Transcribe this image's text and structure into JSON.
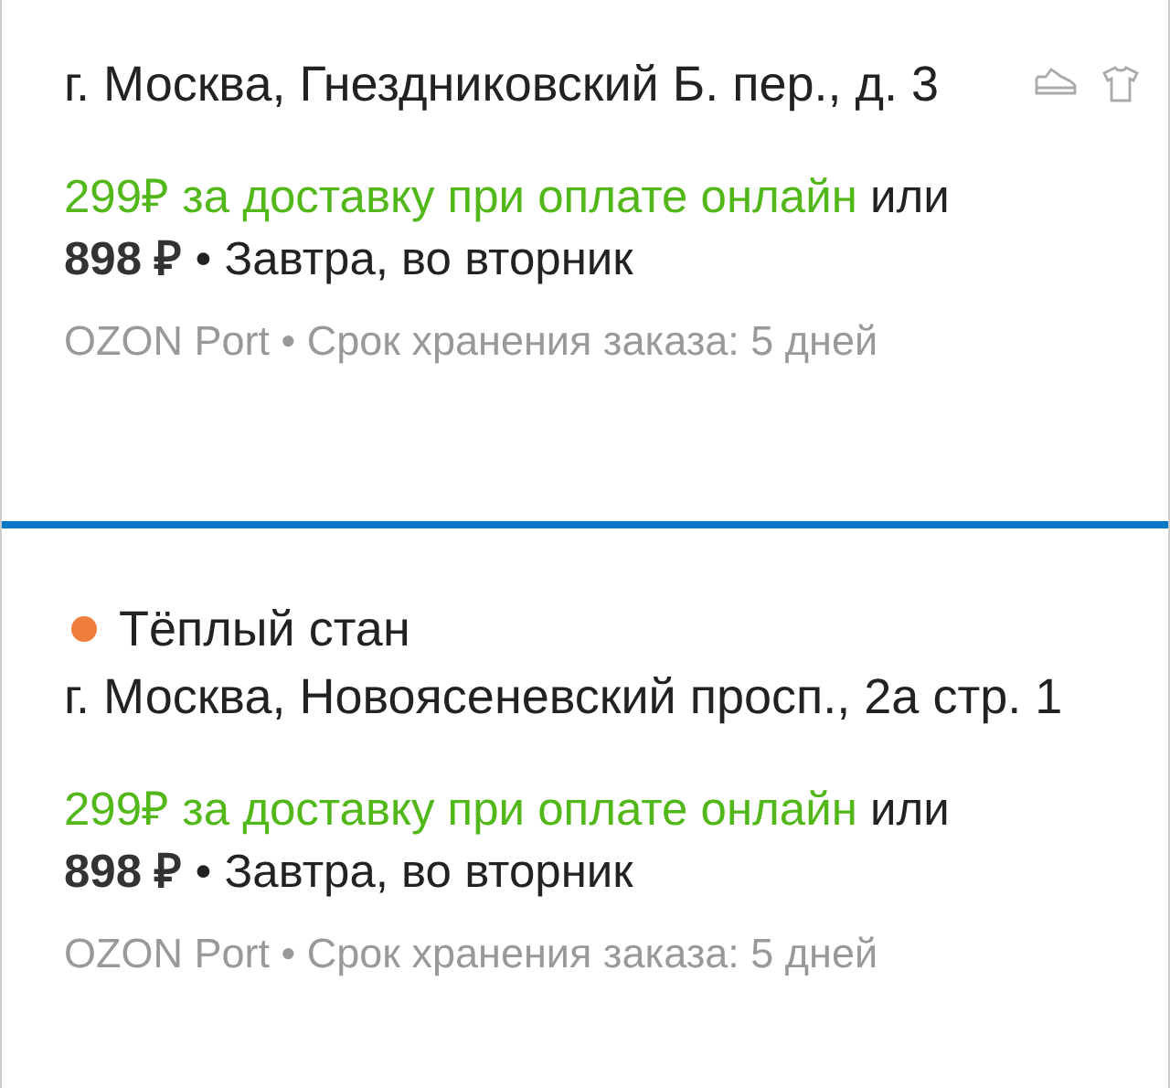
{
  "pickup_points": [
    {
      "selected": true,
      "category_icons": true,
      "address": "г. Москва, Гнездниковский Б. пер., д. 3",
      "offer": "299₽ за доставку при оплате онлайн",
      "conjunction": "или",
      "price": "898 ₽",
      "separator": "•",
      "date": "Завтра, во вторник",
      "details": "OZON Port • Срок хранения заказа: 5 дней"
    },
    {
      "selected": false,
      "category_icons": false,
      "title": "Тёплый стан",
      "color": "#ef7c3b",
      "address": "г. Москва, Новоясеневский просп., 2а стр. 1",
      "offer": "299₽ за доставку при оплате онлайн",
      "conjunction": "или",
      "price": "898 ₽",
      "separator": "•",
      "date": "Завтра, во вторник",
      "details": "OZON Port • Срок хранения заказа: 5 дней"
    }
  ]
}
